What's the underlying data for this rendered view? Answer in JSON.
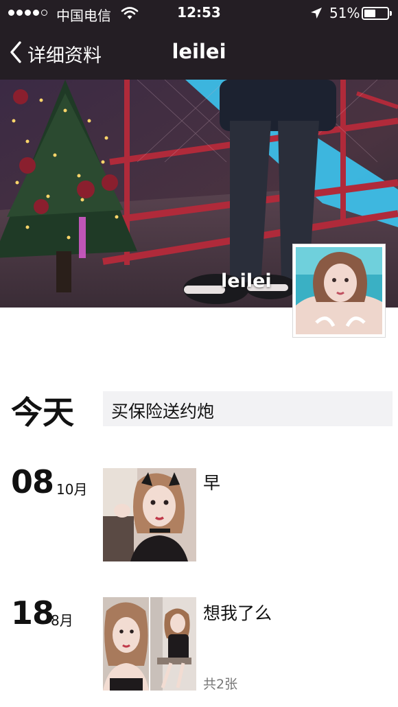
{
  "status_bar": {
    "carrier": "中国电信",
    "time": "12:53",
    "battery_percent": "51%",
    "battery_level": 0.51,
    "icons": [
      "signal-dots",
      "wifi-icon",
      "location-arrow-icon",
      "battery-icon"
    ]
  },
  "nav": {
    "back_label": "详细资料",
    "title": "leilei",
    "back_icon": "chevron-left-icon"
  },
  "profile": {
    "display_name": "leilei"
  },
  "posts": [
    {
      "day": "今天",
      "text": "买保险送约炮"
    },
    {
      "day": "08",
      "month": "10月",
      "text": "早"
    },
    {
      "day": "18",
      "month": "8月",
      "text": "想我了么",
      "photo_count": "共2张"
    }
  ],
  "colors": {
    "bar_background": "#241e24",
    "text_primary": "#111111",
    "text_secondary": "#777777",
    "post_background": "#f2f2f4"
  }
}
